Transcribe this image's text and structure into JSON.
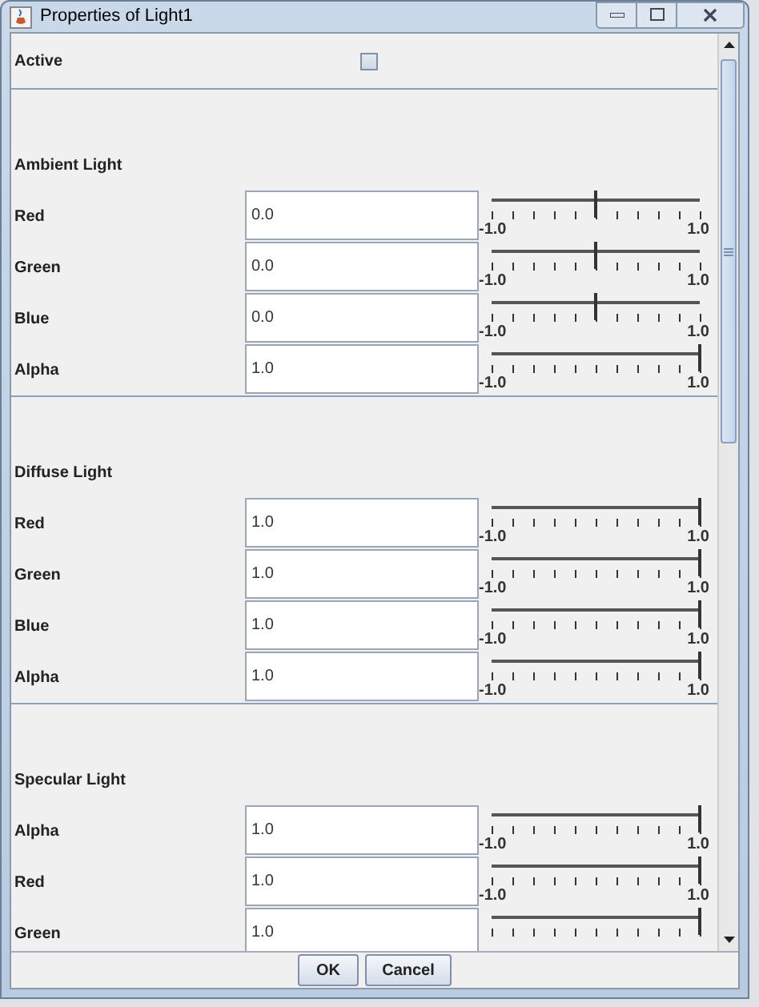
{
  "window": {
    "title": "Properties of Light1"
  },
  "active": {
    "label": "Active",
    "checked": false
  },
  "sections": [
    {
      "title": "Ambient Light",
      "rows": [
        {
          "label": "Red",
          "value": "0.0",
          "level": 0.5,
          "min_label": "-1.0",
          "max_label": "1.0"
        },
        {
          "label": "Green",
          "value": "0.0",
          "level": 0.5,
          "min_label": "-1.0",
          "max_label": "1.0"
        },
        {
          "label": "Blue",
          "value": "0.0",
          "level": 0.5,
          "min_label": "-1.0",
          "max_label": "1.0"
        },
        {
          "label": "Alpha",
          "value": "1.0",
          "level": 1,
          "min_label": "-1.0",
          "max_label": "1.0"
        }
      ]
    },
    {
      "title": "Diffuse Light",
      "rows": [
        {
          "label": "Red",
          "value": "1.0",
          "level": 1,
          "min_label": "-1.0",
          "max_label": "1.0"
        },
        {
          "label": "Green",
          "value": "1.0",
          "level": 1,
          "min_label": "-1.0",
          "max_label": "1.0"
        },
        {
          "label": "Blue",
          "value": "1.0",
          "level": 1,
          "min_label": "-1.0",
          "max_label": "1.0"
        },
        {
          "label": "Alpha",
          "value": "1.0",
          "level": 1,
          "min_label": "-1.0",
          "max_label": "1.0"
        }
      ]
    },
    {
      "title": "Specular Light",
      "rows": [
        {
          "label": "Alpha",
          "value": "1.0",
          "level": 1,
          "min_label": "-1.0",
          "max_label": "1.0"
        },
        {
          "label": "Red",
          "value": "1.0",
          "level": 1,
          "min_label": "-1.0",
          "max_label": "1.0"
        },
        {
          "label": "Green",
          "value": "1.0",
          "level": 1
        }
      ]
    }
  ],
  "buttons": [
    "OK",
    "Cancel"
  ]
}
